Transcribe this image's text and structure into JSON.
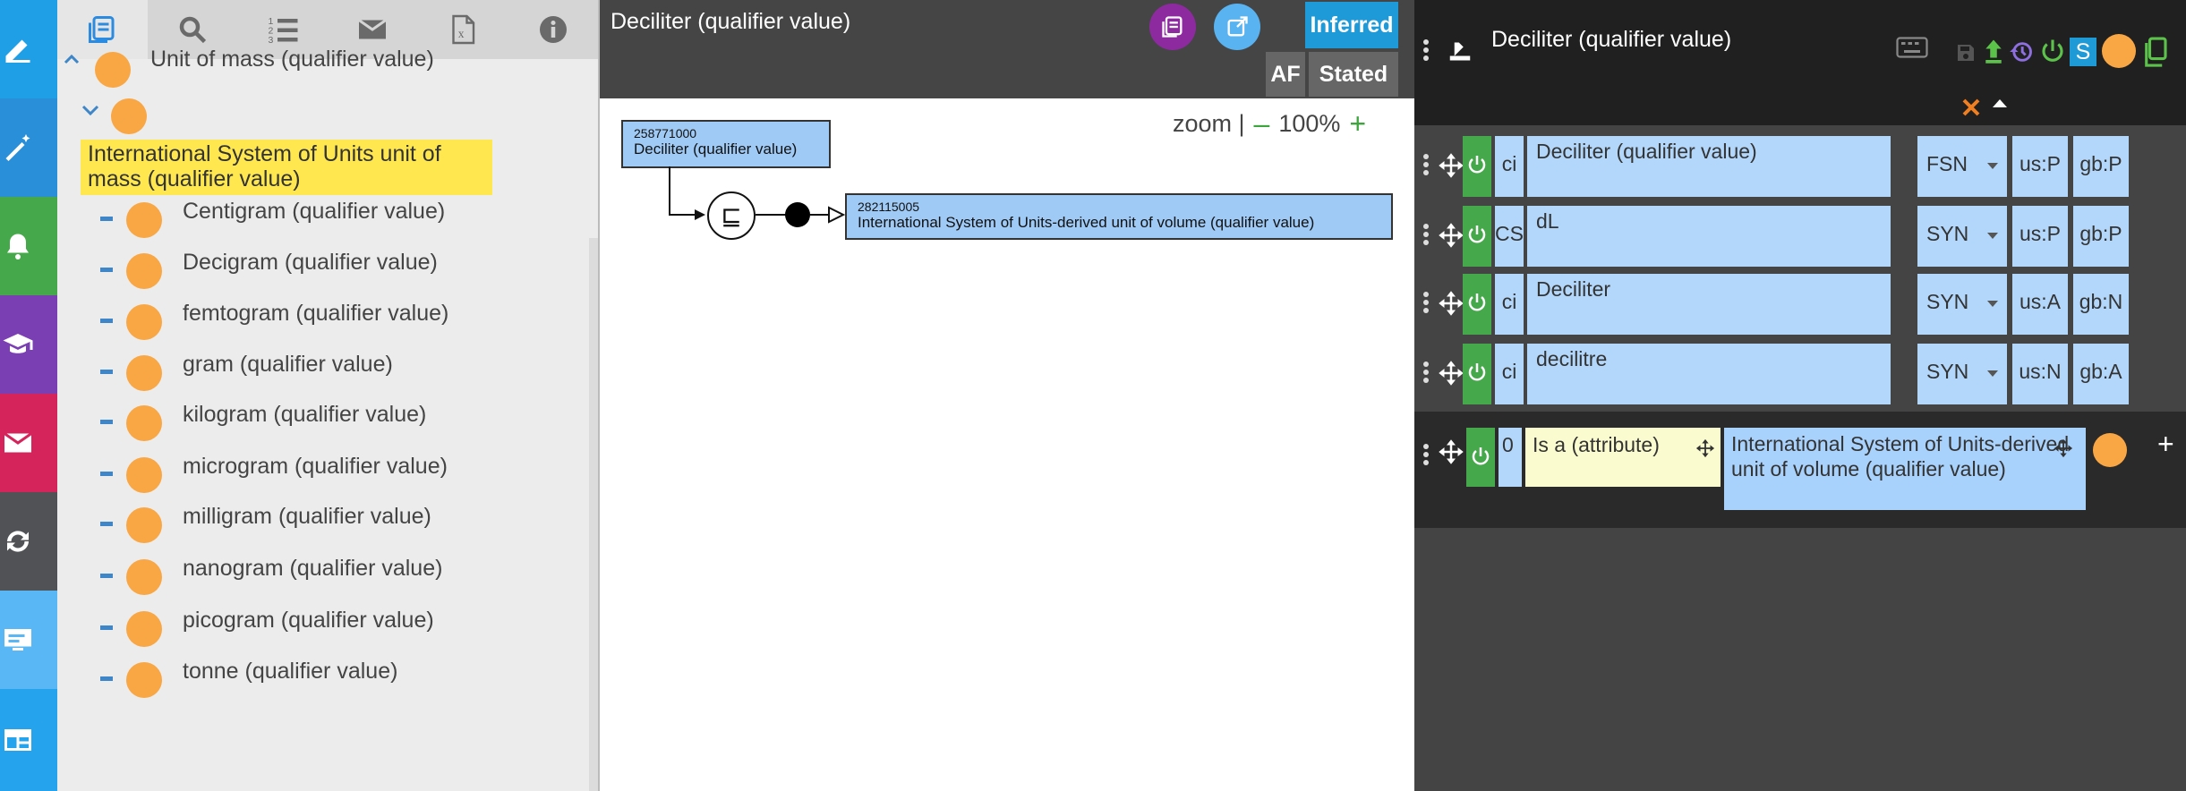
{
  "rail": {
    "items": [
      {
        "name": "edit-icon",
        "color": "#1e9fe6"
      },
      {
        "name": "magic-wand-icon",
        "color": "#2a8fd9"
      },
      {
        "name": "bell-icon",
        "color": "#45a84a"
      },
      {
        "name": "graduation-cap-icon",
        "color": "#7b3fb4"
      },
      {
        "name": "envelope-icon",
        "color": "#d4245b"
      },
      {
        "name": "sync-icon",
        "color": "#505255"
      },
      {
        "name": "desktop-icon",
        "color": "#59b7f5"
      },
      {
        "name": "layout-icon",
        "color": "#25a4ed"
      }
    ]
  },
  "taxonomy": {
    "toolbar": [
      "taxonomy-icon",
      "search-icon",
      "ordered-list-icon",
      "envelope-icon",
      "excel-file-icon",
      "info-icon"
    ],
    "parent_label": "Unit of mass (qualifier value)",
    "selected_label": "International System of Units unit of mass (qualifier value)",
    "children": [
      "Centigram (qualifier value)",
      "Decigram (qualifier value)",
      "femtogram (qualifier value)",
      "gram (qualifier value)",
      "kilogram (qualifier value)",
      "microgram (qualifier value)",
      "milligram (qualifier value)",
      "nanogram (qualifier value)",
      "picogram (qualifier value)",
      "tonne (qualifier value)"
    ]
  },
  "diagram": {
    "title": "Deciliter (qualifier value)",
    "inferred_label": "Inferred",
    "af_label": "AF",
    "stated_label": "Stated",
    "zoom_label": "zoom |",
    "zoom_minus": "–",
    "zoom_value": "100%",
    "zoom_plus": "+",
    "concept": {
      "id": "258771000",
      "name": "Deciliter (qualifier value)"
    },
    "parent": {
      "id": "282115005",
      "name": "International System of Units-derived unit of volume (qualifier value)"
    },
    "subsumption_symbol": "⊑"
  },
  "editor": {
    "title": "Deciliter (qualifier value)",
    "descriptions": [
      {
        "case": "ci",
        "term": "Deciliter (qualifier value)",
        "type": "FSN",
        "us": "us:P",
        "gb": "gb:P"
      },
      {
        "case": "CS",
        "term": "dL",
        "type": "SYN",
        "us": "us:P",
        "gb": "gb:P"
      },
      {
        "case": "ci",
        "term": "Deciliter",
        "type": "SYN",
        "us": "us:A",
        "gb": "gb:N"
      },
      {
        "case": "ci",
        "term": "decilitre",
        "type": "SYN",
        "us": "us:N",
        "gb": "gb:A"
      }
    ],
    "relationship": {
      "group": "0",
      "attribute": "Is a (attribute)",
      "target": "International System of Units-derived unit of volume (qualifier value)"
    },
    "s_badge": "S",
    "add_symbol": "+"
  }
}
